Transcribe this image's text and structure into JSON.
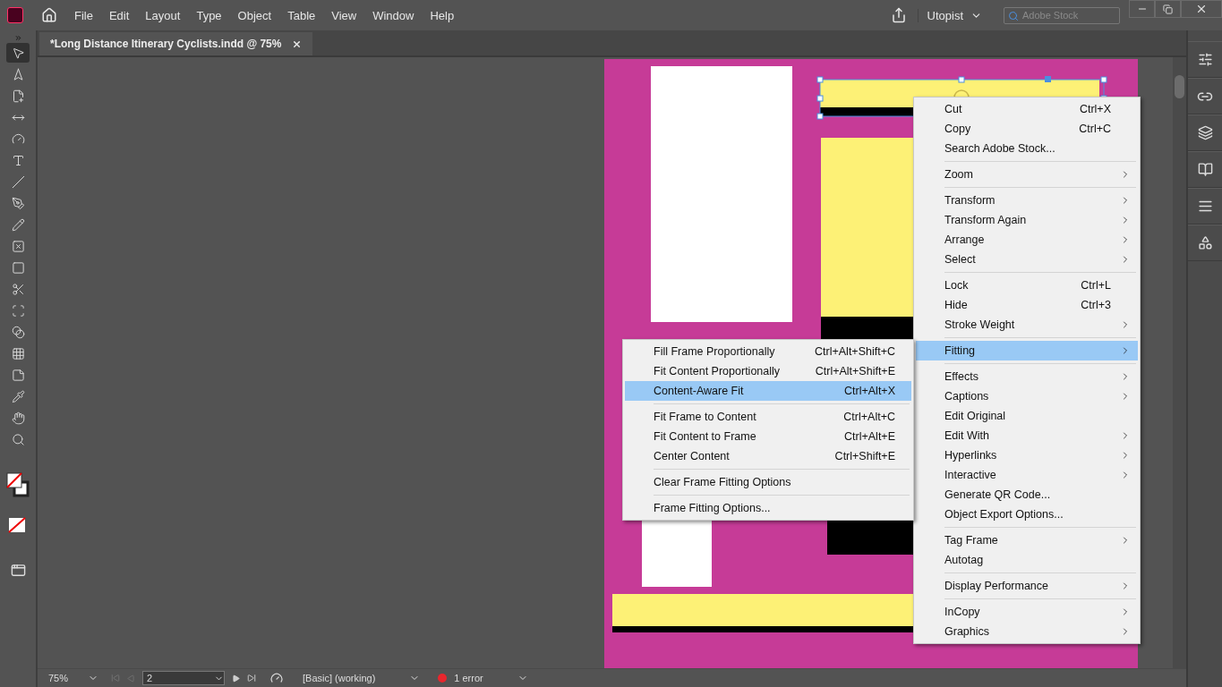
{
  "menu_bar": {
    "items": [
      "File",
      "Edit",
      "Layout",
      "Type",
      "Object",
      "Table",
      "View",
      "Window",
      "Help"
    ],
    "workspace": "Utopist",
    "search": {
      "placeholder": "Adobe Stock"
    }
  },
  "document_tab": {
    "title": "*Long Distance Itinerary Cyclists.indd @ 75%",
    "selected": true
  },
  "tools": [
    {
      "kind": "selection",
      "selected": true
    },
    {
      "kind": "direct-selection",
      "selected": false
    },
    {
      "kind": "page",
      "selected": false
    },
    {
      "kind": "gap",
      "selected": false
    },
    {
      "kind": "content-collector",
      "selected": false
    },
    {
      "kind": "type",
      "selected": false
    },
    {
      "kind": "line",
      "selected": false
    },
    {
      "kind": "pen",
      "selected": false
    },
    {
      "kind": "pencil",
      "selected": false
    },
    {
      "kind": "frame",
      "selected": false
    },
    {
      "kind": "rectangle",
      "selected": false
    },
    {
      "kind": "scissors",
      "selected": false
    },
    {
      "kind": "transform",
      "selected": false
    },
    {
      "kind": "gradient",
      "selected": false
    },
    {
      "kind": "feather",
      "selected": false
    },
    {
      "kind": "note",
      "selected": false
    },
    {
      "kind": "eyedropper",
      "selected": false
    },
    {
      "kind": "hand",
      "selected": false
    },
    {
      "kind": "zoom",
      "selected": false
    }
  ],
  "context_menu": {
    "groups": [
      [
        {
          "label": "Cut",
          "shortcut": "Ctrl+X",
          "submenu": false,
          "selected": false
        },
        {
          "label": "Copy",
          "shortcut": "Ctrl+C",
          "submenu": false,
          "selected": false
        },
        {
          "label": "Search Adobe Stock...",
          "submenu": false,
          "selected": false
        }
      ],
      [
        {
          "label": "Zoom",
          "submenu": true,
          "selected": false
        }
      ],
      [
        {
          "label": "Transform",
          "submenu": true,
          "selected": false
        },
        {
          "label": "Transform Again",
          "submenu": true,
          "selected": false
        },
        {
          "label": "Arrange",
          "submenu": true,
          "selected": false
        },
        {
          "label": "Select",
          "submenu": true,
          "selected": false
        }
      ],
      [
        {
          "label": "Lock",
          "shortcut": "Ctrl+L",
          "submenu": false,
          "selected": false
        },
        {
          "label": "Hide",
          "shortcut": "Ctrl+3",
          "submenu": false,
          "selected": false
        },
        {
          "label": "Stroke Weight",
          "submenu": true,
          "selected": false
        }
      ],
      [
        {
          "label": "Fitting",
          "submenu": true,
          "selected": true
        }
      ],
      [
        {
          "label": "Effects",
          "submenu": true,
          "selected": false
        },
        {
          "label": "Captions",
          "submenu": true,
          "selected": false
        },
        {
          "label": "Edit Original",
          "submenu": false,
          "selected": false
        },
        {
          "label": "Edit With",
          "submenu": true,
          "selected": false
        },
        {
          "label": "Hyperlinks",
          "submenu": true,
          "selected": false
        },
        {
          "label": "Interactive",
          "submenu": true,
          "selected": false
        },
        {
          "label": "Generate QR Code...",
          "submenu": false,
          "selected": false
        },
        {
          "label": "Object Export Options...",
          "submenu": false,
          "selected": false
        }
      ],
      [
        {
          "label": "Tag Frame",
          "submenu": true,
          "selected": false
        },
        {
          "label": "Autotag",
          "submenu": false,
          "selected": false
        }
      ],
      [
        {
          "label": "Display Performance",
          "submenu": true,
          "selected": false
        }
      ],
      [
        {
          "label": "InCopy",
          "submenu": true,
          "selected": false
        },
        {
          "label": "Graphics",
          "submenu": true,
          "selected": false
        }
      ]
    ]
  },
  "fitting_submenu": {
    "groups": [
      [
        {
          "label": "Fill Frame Proportionally",
          "shortcut": "Ctrl+Alt+Shift+C",
          "selected": false
        },
        {
          "label": "Fit Content Proportionally",
          "shortcut": "Ctrl+Alt+Shift+E",
          "selected": false
        },
        {
          "label": "Content-Aware Fit",
          "shortcut": "Ctrl+Alt+X",
          "selected": true
        }
      ],
      [
        {
          "label": "Fit Frame to Content",
          "shortcut": "Ctrl+Alt+C",
          "selected": false
        },
        {
          "label": "Fit Content to Frame",
          "shortcut": "Ctrl+Alt+E",
          "selected": false
        },
        {
          "label": "Center Content",
          "shortcut": "Ctrl+Shift+E",
          "selected": false
        }
      ],
      [
        {
          "label": "Clear Frame Fitting Options",
          "selected": false
        }
      ],
      [
        {
          "label": "Frame Fitting Options...",
          "selected": false
        }
      ]
    ]
  },
  "status_bar": {
    "zoom": "75%",
    "page": "2",
    "preflight_profile": "[Basic] (working)",
    "errors": "1 error"
  }
}
